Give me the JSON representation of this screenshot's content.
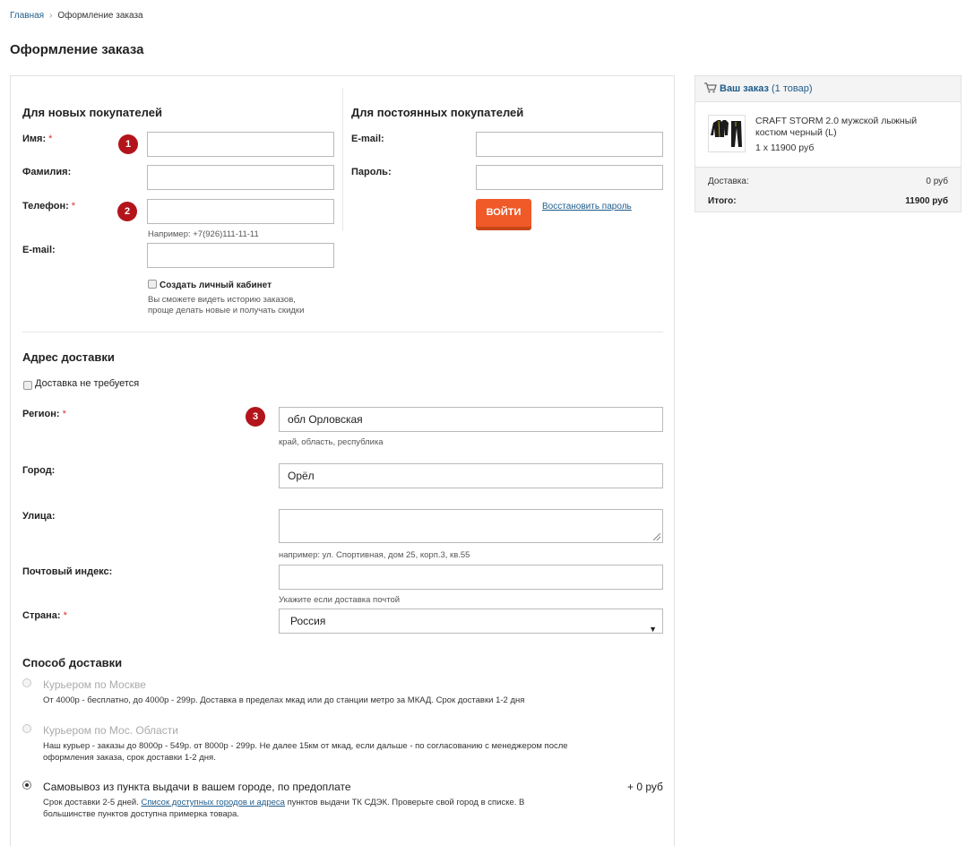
{
  "breadcrumb": {
    "home": "Главная",
    "current": "Оформление заказа"
  },
  "page_title": "Оформление заказа",
  "new_customers": {
    "title": "Для новых покупателей",
    "name_label": "Имя:",
    "surname_label": "Фамилия:",
    "phone_label": "Телефон:",
    "phone_hint": "Например: +7(926)111-11-11",
    "email_label": "E-mail:",
    "create_account_label": "Создать личный кабинет",
    "create_account_hint_1": "Вы сможете видеть историю заказов,",
    "create_account_hint_2": "проще делать новые и получать скидки",
    "name_value": "",
    "surname_value": "",
    "phone_value": "",
    "email_value": ""
  },
  "returning_customers": {
    "title": "Для постоянных покупателей",
    "email_label": "E-mail:",
    "password_label": "Пароль:",
    "login_button": "ВОЙТИ",
    "restore_password": "Восстановить пароль",
    "email_value": "",
    "password_value": ""
  },
  "required_mark": "*",
  "badges": [
    "1",
    "2",
    "3"
  ],
  "address": {
    "title": "Адрес доставки",
    "no_delivery_label": "Доставка не требуется",
    "region_label": "Регион:",
    "region_value": "обл Орловская",
    "region_hint": "край, область, республика",
    "city_label": "Город:",
    "city_value": "Орёл",
    "street_label": "Улица:",
    "street_value": "",
    "street_hint": "например: ул. Спортивная, дом 25, корп.3, кв.55",
    "postal_label": "Почтовый индекс:",
    "postal_value": "",
    "postal_hint": "Укажите если доставка почтой",
    "country_label": "Страна:",
    "country_value": "Россия"
  },
  "delivery": {
    "title": "Способ доставки",
    "options": [
      {
        "title": "Курьером по Москве",
        "desc_1": "От 4000р - бесплатно, до 4000р - 299р. Доставка в пределах мкад или до станции метро за МКАД. Срок доставки 1-2 дня",
        "desc_2": "",
        "selected": false
      },
      {
        "title": "Курьером по Мос. Области",
        "desc_1": "Наш курьер - заказы до 8000р - 549р. от 8000р - 299р. Не далее 15км от мкад, если дальше - по согласованию с менеджером после",
        "desc_2": "оформления заказа, срок доставки 1-2 дня.",
        "selected": false
      },
      {
        "title": "Самовывоз из пункта выдачи в вашем городе, по предоплате",
        "price": "+ 0 руб",
        "desc_pre": "Срок доставки 2-5 дней.",
        "desc_link": "Список доступных городов и адреса",
        "desc_post": "пунктов выдачи ТК СДЭК. Проверьте свой город в списке. В",
        "desc_2": "большинстве пунктов доступна примерка товара.",
        "selected": true
      }
    ]
  },
  "order_summary": {
    "title": "Ваш заказ",
    "count": "(1 товар)",
    "product_name": "CRAFT STORM 2.0 мужской лыжный костюм черный (L)",
    "product_qty": "1 x 11900 руб",
    "delivery_label": "Доставка:",
    "delivery_value": "0 руб",
    "total_label": "Итого:",
    "total_value": "11900 руб"
  },
  "icons": {
    "cart": "cart-icon",
    "chevron": "chevron-right-icon",
    "select_arrow": "triangle-down-icon"
  },
  "colors": {
    "link": "#1f5c8b",
    "button": "#ef5a28",
    "badge": "#b3141b",
    "required": "#d9302b"
  }
}
